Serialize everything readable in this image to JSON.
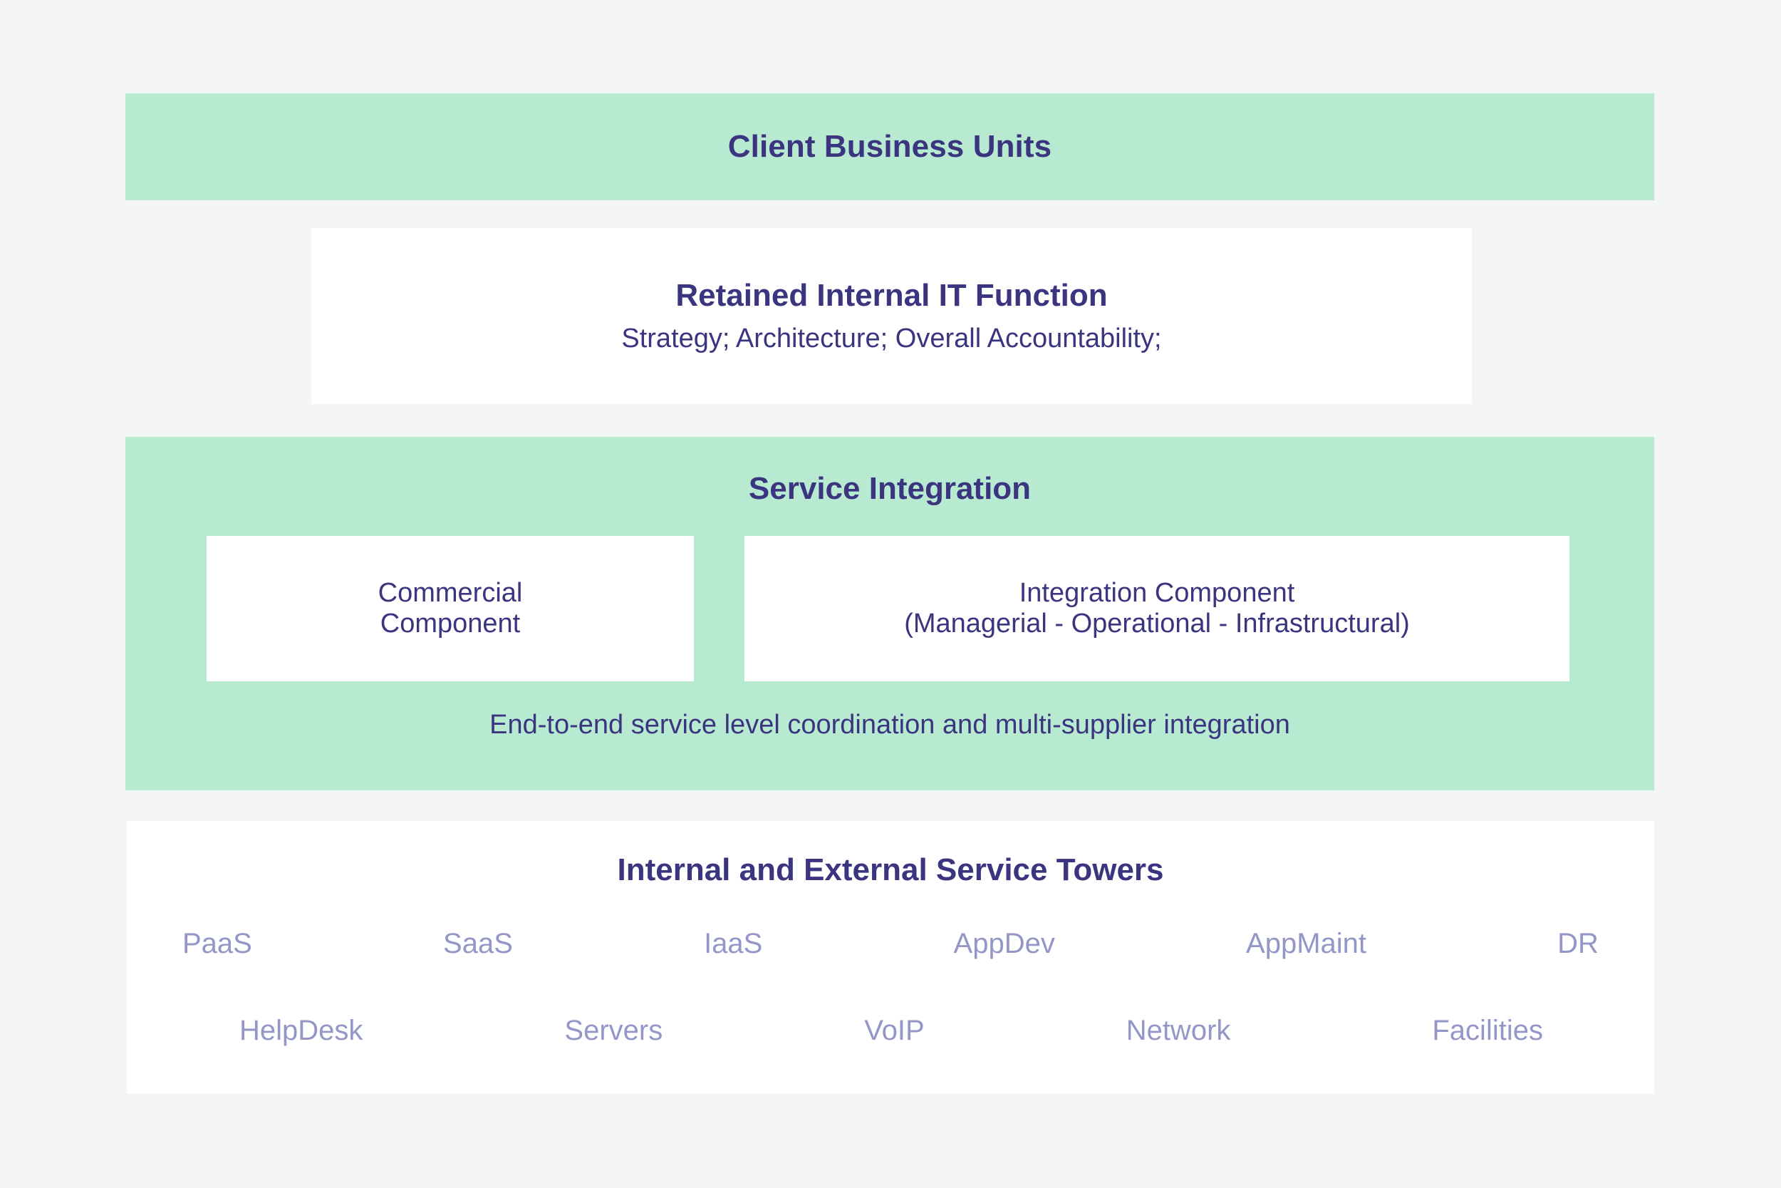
{
  "colors": {
    "page_background": "#f4f5f5",
    "band_green": "#b8ead2",
    "band_white": "#ffffff",
    "heading_navy": "#3b3580",
    "tower_label_lavender": "#9396c6"
  },
  "client_band": {
    "title": "Client Business Units"
  },
  "retained_band": {
    "title": "Retained Internal IT Function",
    "subtitle": "Strategy; Architecture; Overall Accountability;"
  },
  "integration_band": {
    "title": "Service Integration",
    "commercial_box": "Commercial\nComponent",
    "integration_box": "Integration Component\n(Managerial - Operational - Infrastructural)",
    "footnote": "End-to-end service level coordination and multi-supplier integration"
  },
  "towers_band": {
    "title": "Internal and External Service Towers",
    "row1": [
      "PaaS",
      "SaaS",
      "IaaS",
      "AppDev",
      "AppMaint",
      "DR"
    ],
    "row2": [
      "HelpDesk",
      "Servers",
      "VoIP",
      "Network",
      "Facilities"
    ]
  }
}
